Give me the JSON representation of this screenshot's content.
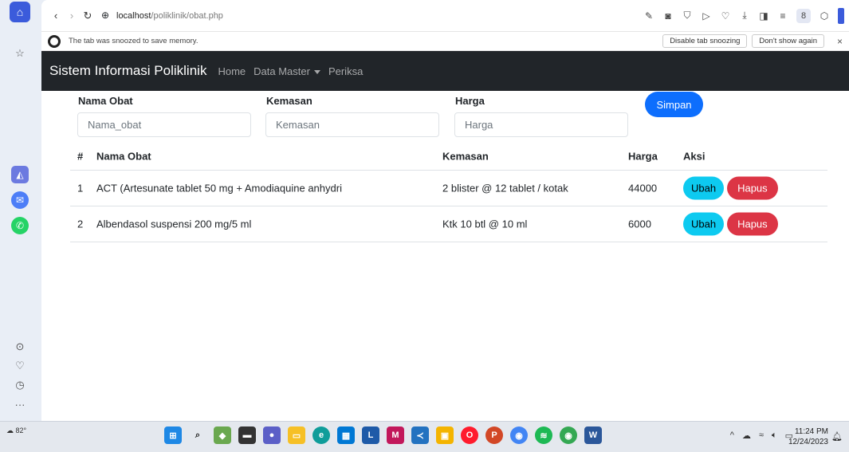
{
  "browser": {
    "url_host": "localhost",
    "url_path": "/poliklinik/obat.php",
    "snooze_message": "The tab was snoozed to save memory.",
    "snooze_disable": "Disable tab snoozing",
    "snooze_dont_show": "Don't show again",
    "user_initial": "8"
  },
  "navbar": {
    "brand": "Sistem Informasi Poliklinik",
    "links": [
      "Home",
      "Data Master",
      "Periksa"
    ]
  },
  "form": {
    "labels": {
      "nama": "Nama Obat",
      "kemasan": "Kemasan",
      "harga": "Harga"
    },
    "placeholders": {
      "nama": "Nama_obat",
      "kemasan": "Kemasan",
      "harga": "Harga"
    },
    "submit_label": "Simpan"
  },
  "table": {
    "headers": {
      "no": "#",
      "nama": "Nama Obat",
      "kemasan": "Kemasan",
      "harga": "Harga",
      "aksi": "Aksi"
    },
    "rows": [
      {
        "no": "1",
        "nama": "ACT (Artesunate tablet 50 mg + Amodiaquine anhydri",
        "kemasan": "2 blister @ 12 tablet / kotak",
        "harga": "44000",
        "ubah": "Ubah",
        "hapus": "Hapus"
      },
      {
        "no": "2",
        "nama": "Albendasol suspensi 200 mg/5 ml",
        "kemasan": "Ktk 10 btl @ 10 ml",
        "harga": "6000",
        "ubah": "Ubah",
        "hapus": "Hapus"
      }
    ]
  },
  "taskbar": {
    "weather": "82°",
    "time": "11:24 PM",
    "date": "12/24/2023"
  },
  "colors": {
    "navbar_bg": "#212529",
    "primary": "#0d6efd",
    "info": "#0dcaf0",
    "danger": "#dc3545"
  }
}
